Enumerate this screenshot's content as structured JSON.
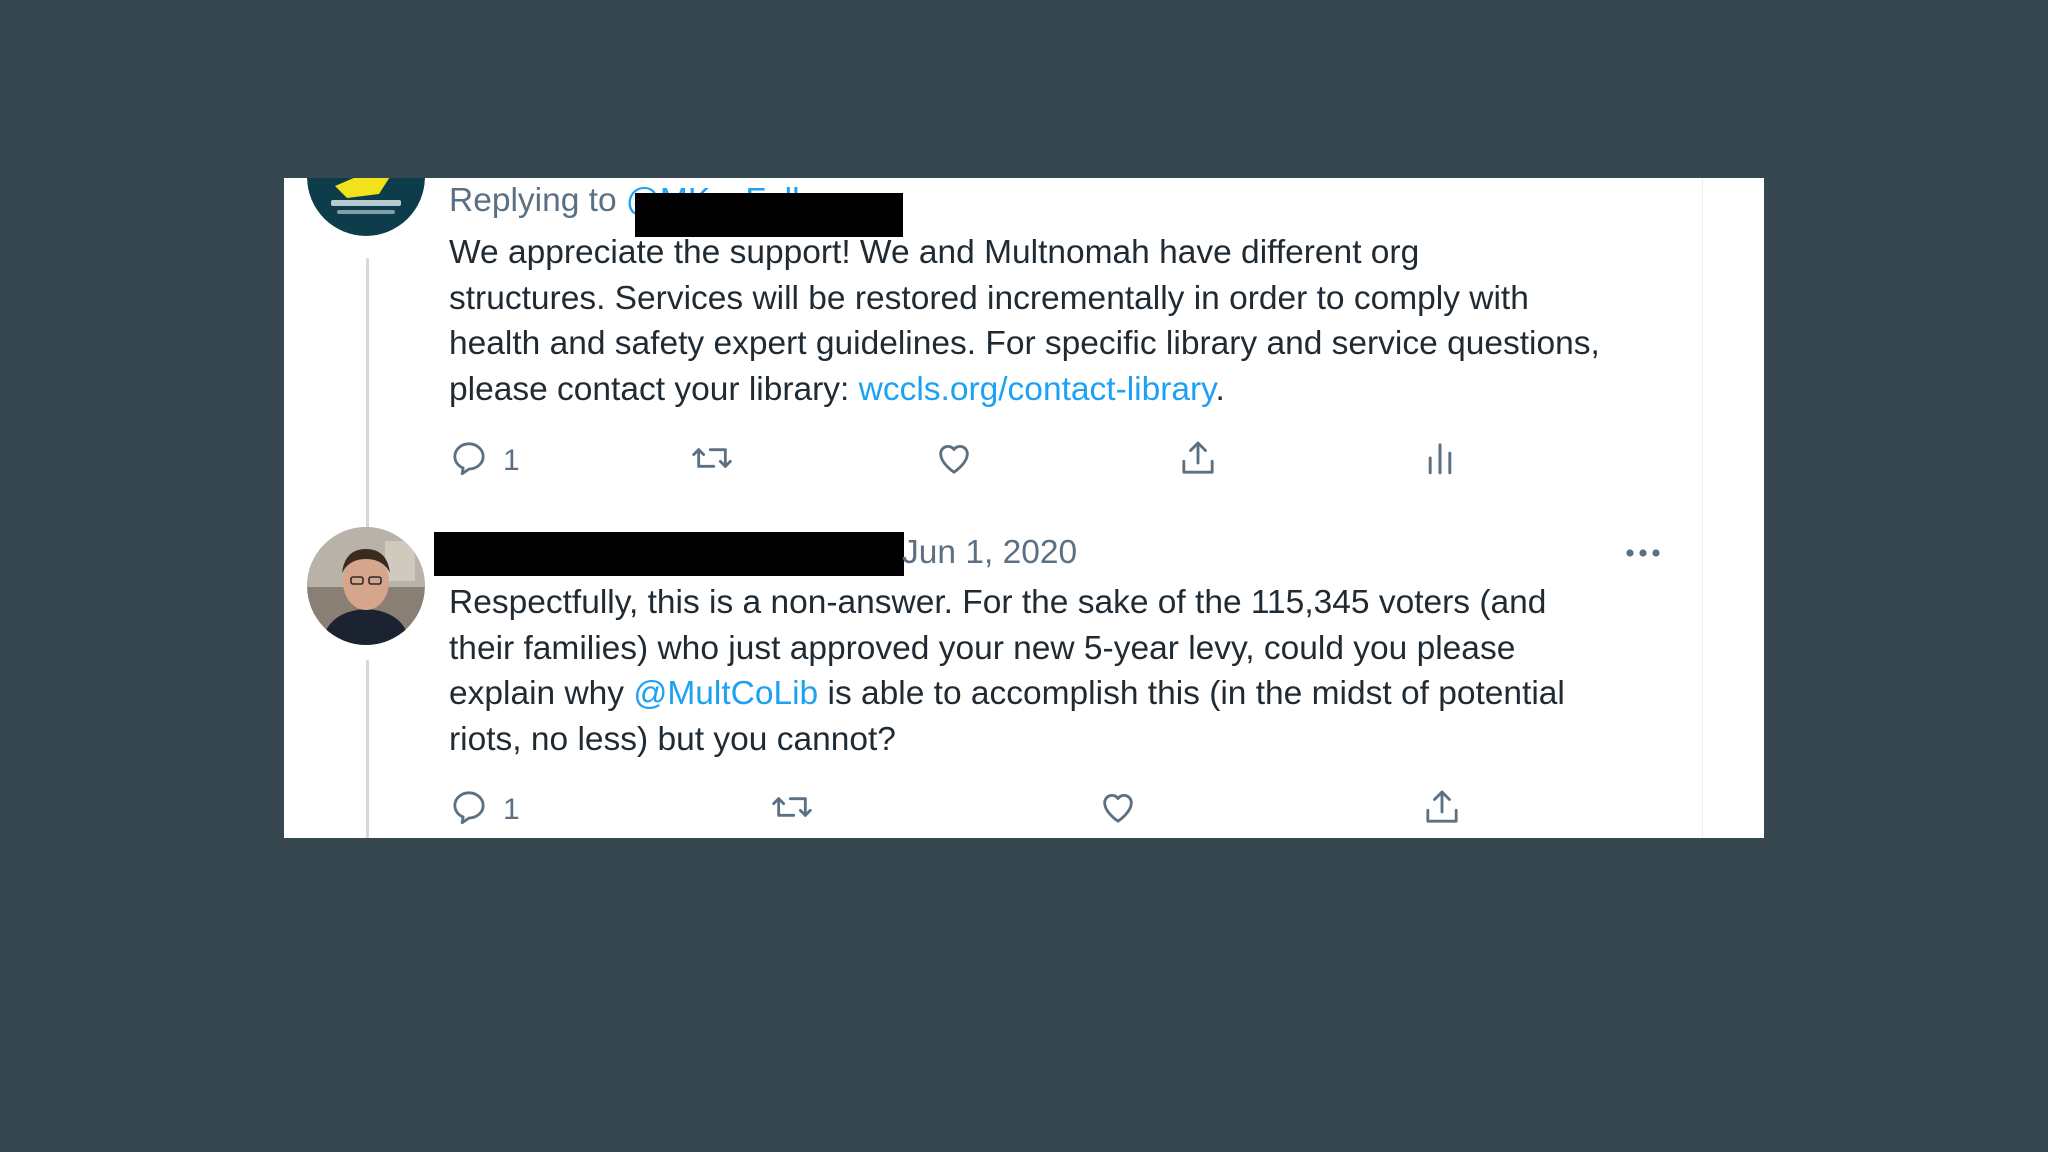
{
  "tweet1": {
    "avatar_icon": "washington-county-library-logo",
    "replying_prefix": "Replying to",
    "replying_handle": "@MKayFall",
    "text_lines": [
      "We appreciate the support! We and Multnomah have different org",
      "structures. Services will be restored incrementally in order to comply with",
      "health and safety expert guidelines. For specific library and service questions,"
    ],
    "text_last_prefix": "please contact your library: ",
    "link": "wccls.org/contact-library",
    "text_last_suffix": ".",
    "actions": {
      "reply_count": "1",
      "reply_icon": "reply-icon",
      "retweet_icon": "retweet-icon",
      "like_icon": "heart-icon",
      "share_icon": "share-icon",
      "analytics_icon": "analytics-icon"
    }
  },
  "tweet2": {
    "avatar_icon": "user-photo-avatar",
    "date": "Jun 1, 2020",
    "more_icon": "more-options-icon",
    "text_lines": [
      "Respectfully, this is a non-answer. For the sake of the 115,345 voters (and",
      "their families) who just approved your new 5-year levy, could you please"
    ],
    "line3_prefix": "explain why ",
    "mention": "@MultCoLib",
    "line3_suffix": " is able to accomplish this (in the midst of potential",
    "line4": "riots, no less) but you cannot?",
    "actions": {
      "reply_count": "1",
      "reply_icon": "reply-icon",
      "retweet_icon": "retweet-icon",
      "like_icon": "heart-icon",
      "share_icon": "share-icon"
    }
  },
  "colors": {
    "background": "#37474f",
    "card": "#ffffff",
    "link": "#1da1f2",
    "muted": "#5b7083",
    "text": "#1f2a33"
  }
}
